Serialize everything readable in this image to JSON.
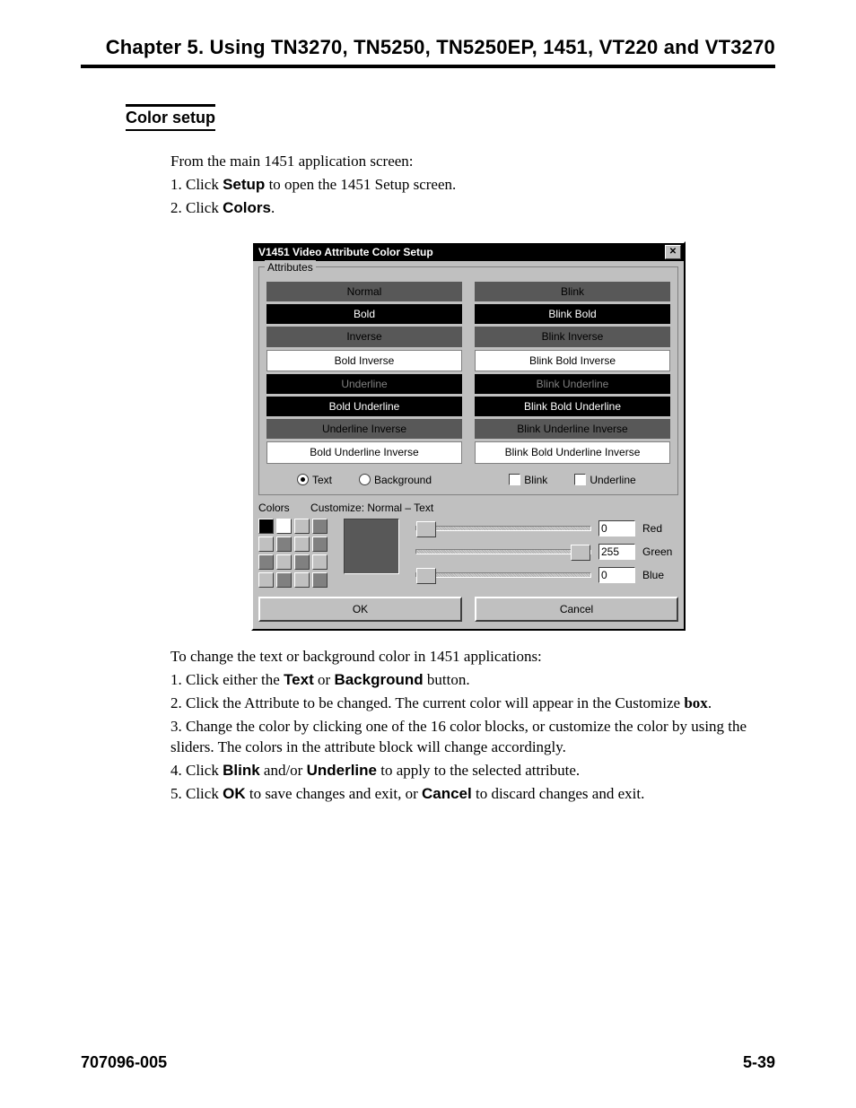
{
  "chapter_title": "Chapter 5.  Using  TN3270, TN5250, TN5250EP, 1451, VT220 and VT3270",
  "section_heading": "Color setup",
  "intro": {
    "line0": "From the main 1451 application screen:",
    "step1_prefix": "1. Click ",
    "step1_bold": "Setup",
    "step1_suffix": " to open the 1451 Setup screen.",
    "step2_prefix": "2. Click ",
    "step2_bold": "Colors",
    "step2_suffix": "."
  },
  "dialog": {
    "title": "V1451 Video Attribute Color Setup",
    "attributes_label": "Attributes",
    "attrs": {
      "a0": "Normal",
      "b0": "Blink",
      "a1": "Bold",
      "b1": "Blink Bold",
      "a2": "Inverse",
      "b2": "Blink Inverse",
      "a3": "Bold Inverse",
      "b3": "Blink Bold Inverse",
      "a4": "Underline",
      "b4": "Blink Underline",
      "a5": "Bold Underline",
      "b5": "Blink Bold Underline",
      "a6": "Underline Inverse",
      "b6": "Blink Underline Inverse",
      "a7": "Bold Underline Inverse",
      "b7": "Blink Bold Underline Inverse"
    },
    "radio": {
      "text": "Text",
      "background": "Background"
    },
    "check": {
      "blink": "Blink",
      "underline": "Underline"
    },
    "colors_label": "Colors",
    "customize_label": "Customize:  Normal – Text",
    "rgb": {
      "red": {
        "val": "0",
        "label": "Red"
      },
      "green": {
        "val": "255",
        "label": "Green"
      },
      "blue": {
        "val": "0",
        "label": "Blue"
      }
    },
    "swatches": [
      "#000000",
      "#ffffff",
      "#c0c0c0",
      "#808080",
      "#c0c0c0",
      "#808080",
      "#c0c0c0",
      "#808080",
      "#808080",
      "#c0c0c0",
      "#808080",
      "#c0c0c0",
      "#c0c0c0",
      "#808080",
      "#c0c0c0",
      "#808080"
    ],
    "ok": "OK",
    "cancel": "Cancel"
  },
  "outro": {
    "line0": "To change the text or background color in 1451 applications:",
    "s1_a": "1. Click either the ",
    "s1_b1": "Text",
    "s1_c": " or ",
    "s1_b2": "Background",
    "s1_d": " button.",
    "s2": "2. Click the Attribute to be changed. The current color will appear in the Customize ",
    "s2_bold": "box",
    "s2_suffix": ".",
    "s3": "3. Change the color by clicking one of the 16 color blocks, or customize the color by using the sliders. The colors in the attribute block will change accordingly.",
    "s4_a": "4. Click ",
    "s4_b1": "Blink",
    "s4_c": " and/or ",
    "s4_b2": "Underline",
    "s4_d": " to apply to the selected attribute.",
    "s5_a": "5. Click ",
    "s5_b1": "OK",
    "s5_c": " to save changes and exit, or ",
    "s5_b2": "Cancel",
    "s5_d": " to discard changes and exit."
  },
  "footer": {
    "left": "707096-005",
    "right": "5-39"
  }
}
